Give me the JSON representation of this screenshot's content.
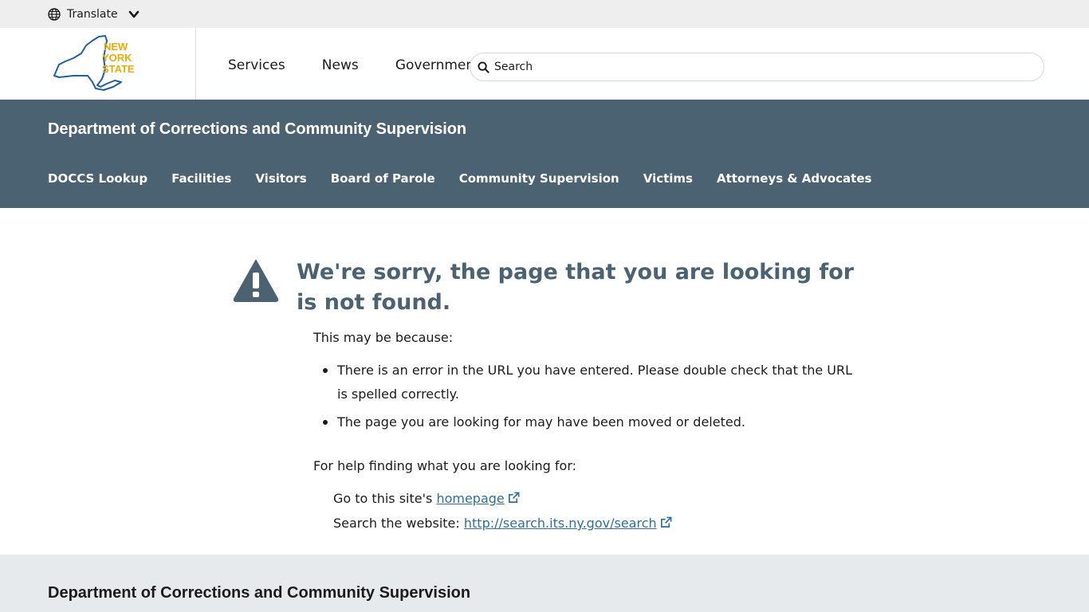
{
  "translate": {
    "label": "Translate"
  },
  "global_nav": {
    "items": [
      {
        "label": "Services"
      },
      {
        "label": "News"
      },
      {
        "label": "Government"
      }
    ],
    "search_placeholder": "Search"
  },
  "logo": {
    "text": "NEW YORK STATE",
    "color": "#f2a900",
    "outline_color": "#1f5fa8"
  },
  "agency": {
    "title": "Department of Corrections and Community Supervision",
    "nav": [
      {
        "label": "DOCCS Lookup"
      },
      {
        "label": "Facilities"
      },
      {
        "label": "Visitors"
      },
      {
        "label": "Board of Parole"
      },
      {
        "label": "Community Supervision"
      },
      {
        "label": "Victims"
      },
      {
        "label": "Attorneys & Advocates"
      }
    ],
    "bg_color": "#4b6273"
  },
  "error": {
    "heading": "We're sorry, the page that you are looking for is not found.",
    "reason_intro": "This may be because:",
    "reasons": [
      "There is an error in the URL you have entered. Please double check that the URL is spelled correctly.",
      "The page you are looking for may have been moved or deleted."
    ],
    "help_intro": "For help finding what you are looking for:",
    "help_home_prefix": "Go to this site's",
    "help_home_link": "homepage",
    "help_search_prefix": "Search the website:",
    "help_search_link": "http://search.its.ny.gov/search"
  },
  "footer": {
    "title": "Department of Corrections and Community Supervision"
  },
  "colors": {
    "link": "#2f6fa0",
    "heading": "#4b6273",
    "footer_bg": "#e6eaed"
  }
}
